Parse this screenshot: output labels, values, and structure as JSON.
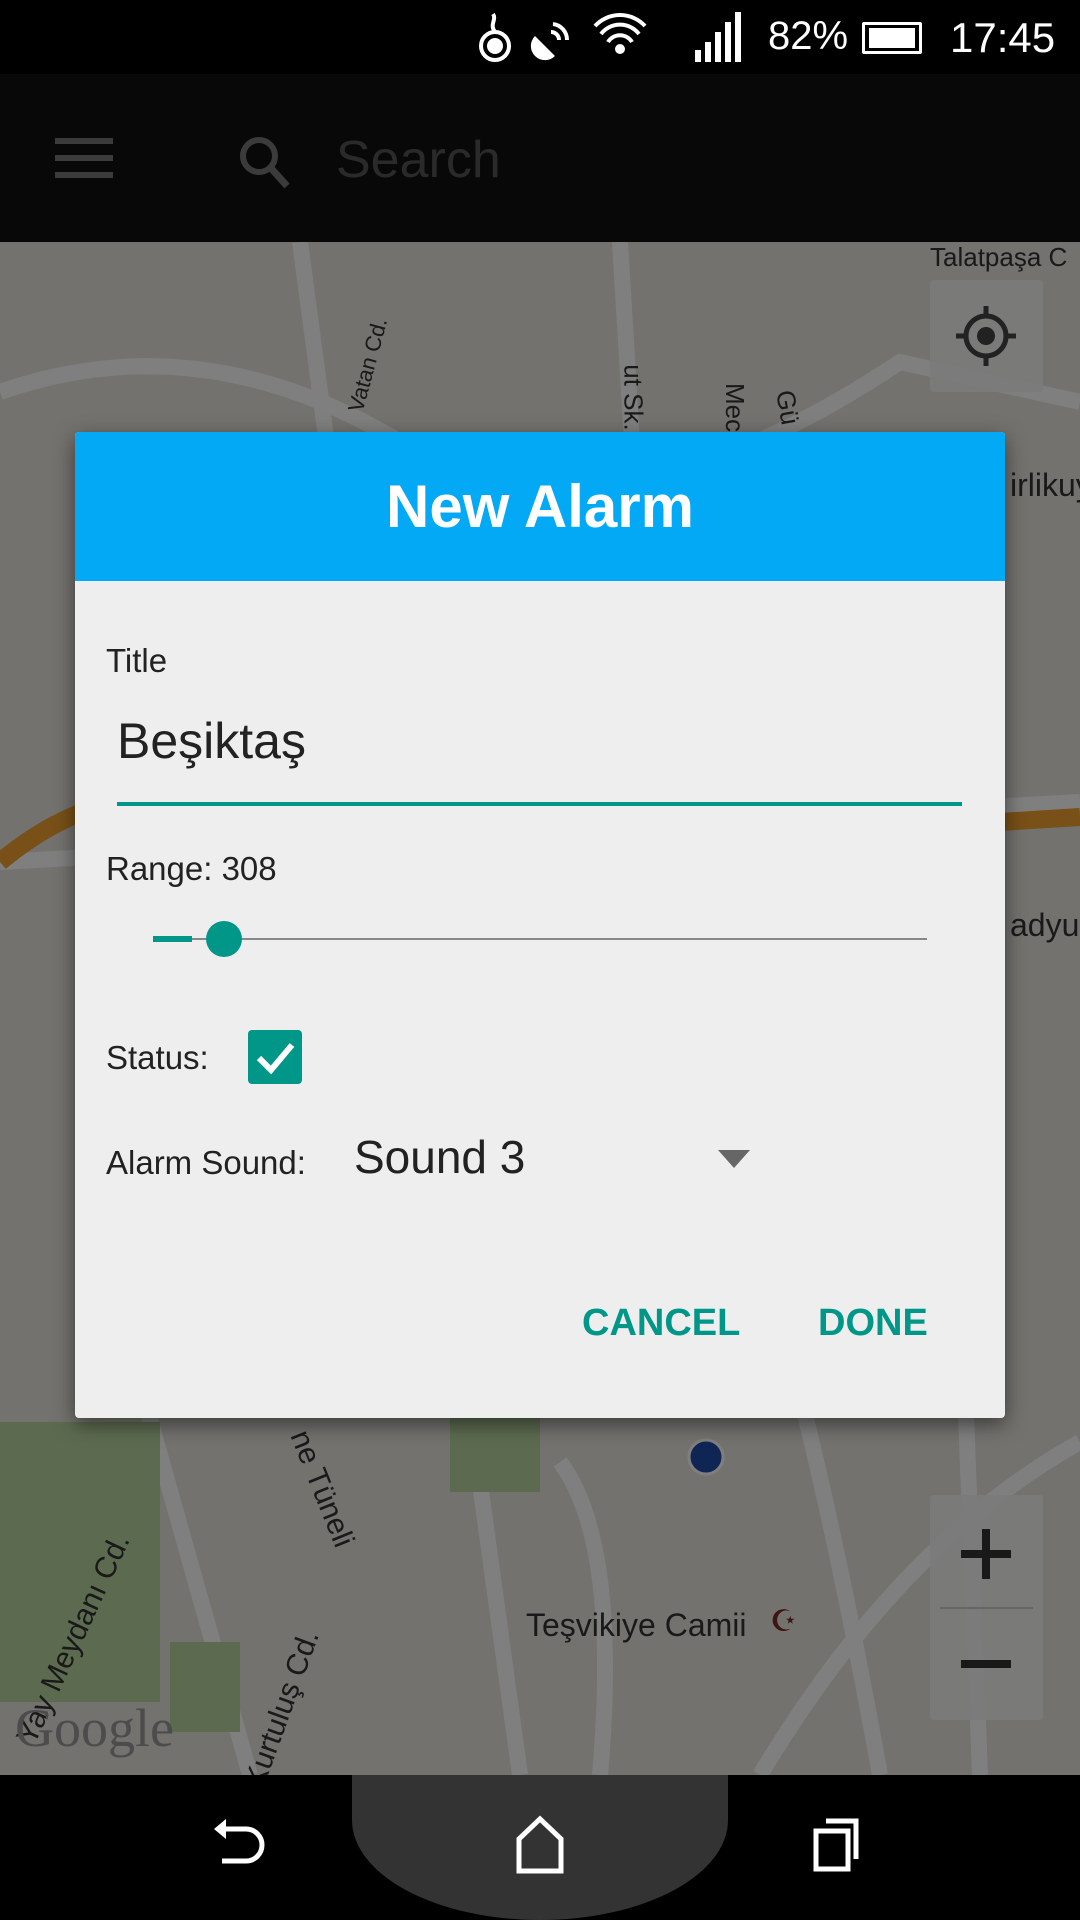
{
  "status_bar": {
    "battery": "82%",
    "time": "17:45",
    "icons": [
      "hotspot-icon",
      "satellite-icon",
      "wifi-icon",
      "signal-icon",
      "battery-icon"
    ]
  },
  "toolbar": {
    "menu_icon": "hamburger-icon",
    "search_icon": "search-icon",
    "search_placeholder": "Search"
  },
  "map": {
    "labels": [
      "Talatpaşa C",
      "Vatan Cd.",
      "ut Sk.",
      "Mec",
      "Gü",
      "irlikuy",
      "adyu",
      "ne Tüneli",
      "Yay Meydanı Cd.",
      "Kurtuluş Cd.",
      "Teşvikiye Camii"
    ],
    "logo": "Google"
  },
  "dialog": {
    "title": "New Alarm",
    "title_label": "Title",
    "title_value": "Beşiktaş",
    "range_label": "Range: 308",
    "range_fraction": 0.05,
    "status_label": "Status:",
    "status_checked": true,
    "sound_label": "Alarm Sound:",
    "sound_value": "Sound 3",
    "cancel": "CANCEL",
    "done": "DONE"
  },
  "colors": {
    "accent": "#009688",
    "header": "#03A9F4"
  },
  "nav": {
    "back": "back-icon",
    "home": "home-icon",
    "recents": "recents-icon"
  }
}
